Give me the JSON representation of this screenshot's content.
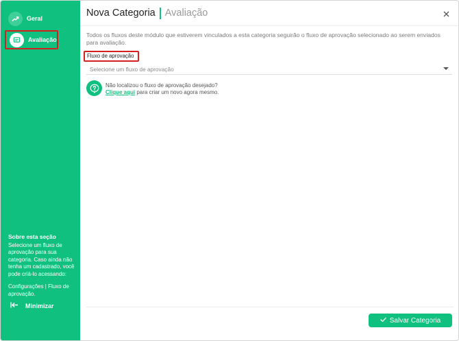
{
  "sidebar": {
    "items": [
      {
        "label": "Geral",
        "icon": "check-chart-icon"
      },
      {
        "label": "Avaliação",
        "icon": "review-card-icon"
      }
    ],
    "about": {
      "title": "Sobre esta seção",
      "text": "Selecione um fluxo de aprovação para sua categoria. Caso ainda não tenha um cadastrado, você pode criá-lo acessando:",
      "path": "Configurações | Fluxo de aprovação."
    },
    "minimize_label": "Minimizar"
  },
  "header": {
    "title": "Nova Categoria",
    "subtitle": "Avaliação"
  },
  "main": {
    "description": "Todos os fluxos deste módulo que estiverem vinculados a esta categoria seguirão o fluxo de aprovação selecionado ao serem enviados para avaliação.",
    "field_label": "Fluxo de aprovação",
    "select_placeholder": "Selecione um fluxo de aprovação",
    "help_question": "Não localizou o fluxo de aprovação desejado?",
    "help_link": "Clique aqui",
    "help_suffix": " para criar um novo agora mesmo."
  },
  "footer": {
    "save_label": "Salvar Categoria"
  },
  "colors": {
    "brand": "#10c07e",
    "highlight": "#d42020"
  }
}
